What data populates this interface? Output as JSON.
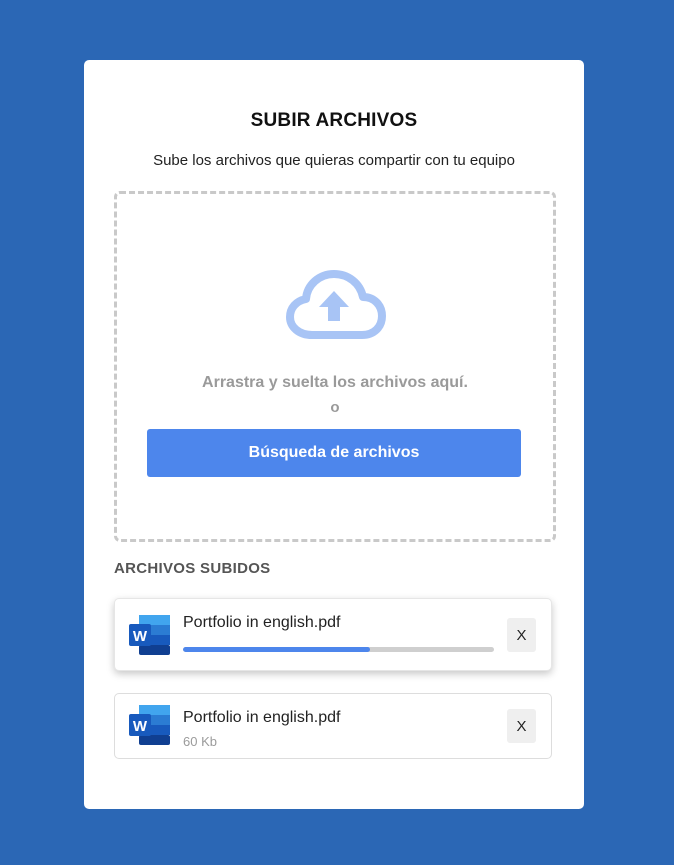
{
  "upload": {
    "title": "SUBIR ARCHIVOS",
    "subtitle": "Sube los archivos que quieras compartir con tu equipo",
    "dropzone": {
      "icon": "cloud-upload-icon",
      "drag_text": "Arrastra y suelta los archivos aquí.",
      "or_text": "o",
      "browse_label": "Búsqueda de archivos"
    }
  },
  "uploaded": {
    "section_title": "ARCHIVOS SUBIDOS",
    "files": [
      {
        "name": "Portfolio in english.pdf",
        "icon": "word-icon",
        "status": "uploading",
        "progress": 0.6,
        "remove_label": "X"
      },
      {
        "name": "Portfolio in english.pdf",
        "icon": "word-icon",
        "status": "done",
        "size": "60 Kb",
        "remove_label": "X"
      }
    ]
  },
  "colors": {
    "background": "#2b67b5",
    "accent": "#4d86ec",
    "cloud": "#a8c4f5"
  }
}
